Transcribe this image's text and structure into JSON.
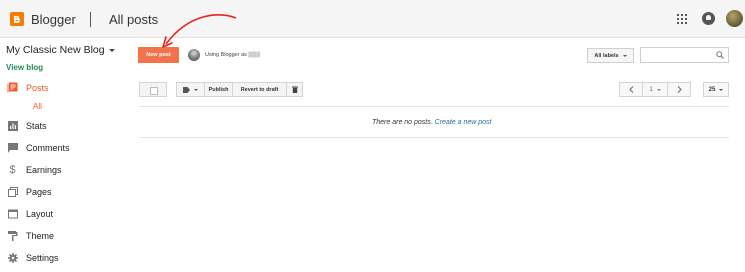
{
  "header": {
    "brand": "Blogger",
    "page_title": "All posts"
  },
  "sidebar": {
    "blog_name": "My Classic New Blog",
    "view_blog": "View blog",
    "items": [
      {
        "label": "Posts",
        "icon": "posts-icon",
        "active": true
      },
      {
        "label": "Stats",
        "icon": "stats-icon"
      },
      {
        "label": "Comments",
        "icon": "comments-icon"
      },
      {
        "label": "Earnings",
        "icon": "earnings-icon"
      },
      {
        "label": "Pages",
        "icon": "pages-icon"
      },
      {
        "label": "Layout",
        "icon": "layout-icon"
      },
      {
        "label": "Theme",
        "icon": "theme-icon"
      },
      {
        "label": "Settings",
        "icon": "settings-icon"
      }
    ],
    "sub_all": "All"
  },
  "toolbar": {
    "new_post": "New post",
    "using_as": "Using Blogger as ▒▒▒",
    "labels": "All labels",
    "publish": "Publish",
    "revert": "Revert to draft",
    "page_number": "1",
    "per_page": "25"
  },
  "empty": {
    "message": "There are no posts.",
    "link": "Create a new post"
  },
  "colors": {
    "accent": "#f3724a",
    "active": "#f1592a",
    "link": "#2a6f9a",
    "view_blog": "#2a8a5a"
  }
}
